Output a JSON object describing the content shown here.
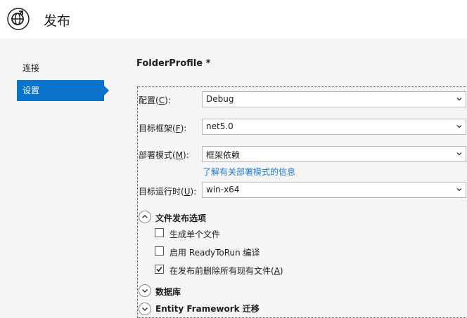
{
  "header": {
    "title": "发布"
  },
  "nav": {
    "items": [
      {
        "label": "连接"
      },
      {
        "label": "设置"
      }
    ]
  },
  "profile": {
    "title": "FolderProfile *"
  },
  "form": {
    "configuration": {
      "label_pre": "配置(",
      "label_key": "C",
      "label_post": "):",
      "value": "Debug"
    },
    "target_framework": {
      "label_pre": "目标框架(",
      "label_key": "F",
      "label_post": "):",
      "value": "net5.0"
    },
    "deployment_mode": {
      "label_pre": "部署模式(",
      "label_key": "M",
      "label_post": "):",
      "value": "框架依赖"
    },
    "deployment_link": "了解有关部署模式的信息",
    "target_runtime": {
      "label_pre": "目标运行时(",
      "label_key": "U",
      "label_post": "):",
      "value": "win-x64"
    }
  },
  "file_options": {
    "title": "文件发布选项",
    "expanded": true,
    "options": [
      {
        "label": "生成单个文件",
        "checked": false
      },
      {
        "label": "启用 ReadyToRun 编译",
        "checked": false
      },
      {
        "label_pre": "在发布前删除所有现有文件(",
        "label_key": "A",
        "label_post": ")",
        "checked": true
      }
    ]
  },
  "database": {
    "title": "数据库",
    "expanded": false
  },
  "ef_migrations": {
    "title": "Entity Framework 迁移",
    "expanded": false
  }
}
